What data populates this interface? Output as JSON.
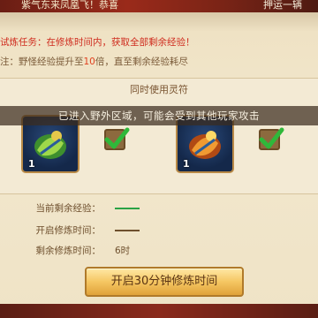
{
  "top_banner": {
    "message": "紫气东来凤凰飞！恭喜",
    "right_text": "押运一辆"
  },
  "info": {
    "line1": "试炼任务：在修炼时间内，获取全部剩余经验！",
    "line2_prefix": "注：野怪经验提升至",
    "line2_highlight": "10",
    "line2_suffix": "倍，直至剩余经验耗尽"
  },
  "panel": {
    "header": "同时使用灵符"
  },
  "toast": "已进入野外区域，可能会受到其他玩家攻击",
  "items": [
    {
      "count": "1",
      "icon": "green-talisman-icon",
      "checked": true
    },
    {
      "count": "1",
      "icon": "orange-talisman-icon",
      "checked": true
    }
  ],
  "stats": {
    "remaining_exp_label": "当前剩余经验：",
    "start_time_label": "开启修炼时间：",
    "remaining_time_label": "剩余修炼时间：",
    "remaining_time_value": "6时"
  },
  "button": {
    "label": "开启30分钟修炼时间"
  },
  "colors": {
    "accent_red": "#cf2b1e",
    "check_green": "#2fb83a",
    "button_gold": "#f5c662"
  }
}
